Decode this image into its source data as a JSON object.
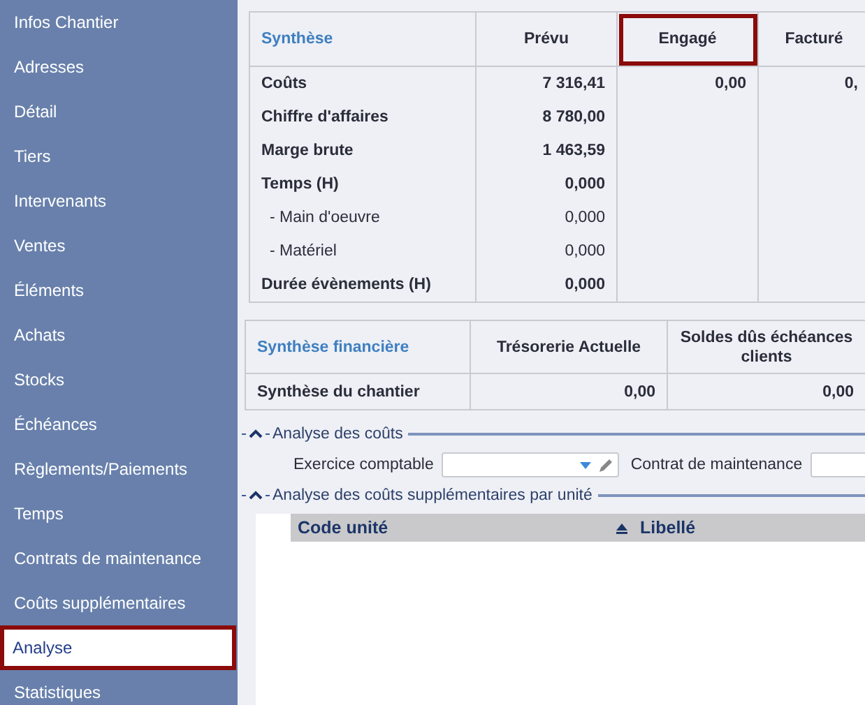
{
  "sidebar": {
    "items": [
      {
        "label": "Infos Chantier",
        "selected": false
      },
      {
        "label": "Adresses",
        "selected": false
      },
      {
        "label": "Détail",
        "selected": false
      },
      {
        "label": "Tiers",
        "selected": false
      },
      {
        "label": "Intervenants",
        "selected": false
      },
      {
        "label": "Ventes",
        "selected": false
      },
      {
        "label": "Éléments",
        "selected": false
      },
      {
        "label": "Achats",
        "selected": false
      },
      {
        "label": "Stocks",
        "selected": false
      },
      {
        "label": "Échéances",
        "selected": false
      },
      {
        "label": "Règlements/Paiements",
        "selected": false
      },
      {
        "label": "Temps",
        "selected": false
      },
      {
        "label": "Contrats de maintenance",
        "selected": false
      },
      {
        "label": "Coûts supplémentaires",
        "selected": false
      },
      {
        "label": "Analyse",
        "selected": true
      },
      {
        "label": "Statistiques",
        "selected": false
      }
    ]
  },
  "synthese": {
    "title": "Synthèse",
    "columns": [
      {
        "label": "Prévu",
        "highlighted": false
      },
      {
        "label": "Engagé",
        "highlighted": true
      },
      {
        "label": "Facturé",
        "highlighted": false
      }
    ],
    "rows": [
      {
        "label": "Coûts",
        "kind": "main",
        "values": [
          "7 316,41",
          "0,00",
          "0,"
        ]
      },
      {
        "label": "Chiffre d'affaires",
        "kind": "main",
        "values": [
          "8 780,00"
        ]
      },
      {
        "label": "Marge brute",
        "kind": "main",
        "values": [
          "1 463,59"
        ]
      },
      {
        "label": "Temps (H)",
        "kind": "main",
        "values": [
          "0,000"
        ]
      },
      {
        "label": "- Main d'oeuvre",
        "kind": "sub",
        "values": [
          "0,000"
        ]
      },
      {
        "label": "- Matériel",
        "kind": "sub",
        "values": [
          "0,000"
        ]
      },
      {
        "label": "Durée évènements (H)",
        "kind": "main",
        "values": [
          "0,000"
        ]
      }
    ]
  },
  "financial": {
    "title": "Synthèse financière",
    "columns": [
      "Trésorerie Actuelle",
      "Soldes dûs échéances clients"
    ],
    "rows": [
      {
        "label": "Synthèse du chantier",
        "values": [
          "0,00",
          "0,00"
        ]
      }
    ]
  },
  "cost_analysis": {
    "title": "Analyse des coûts",
    "expanded": true,
    "fields": [
      {
        "label": "Exercice comptable",
        "kind": "combo"
      },
      {
        "label": "Contrat de maintenance",
        "kind": "text"
      }
    ]
  },
  "unit_analysis": {
    "title": "Analyse des coûts supplémentaires par unité",
    "expanded": true,
    "columns": [
      {
        "label": "Code unité",
        "sorted": false
      },
      {
        "label": "Libellé",
        "sorted": true
      }
    ]
  }
}
